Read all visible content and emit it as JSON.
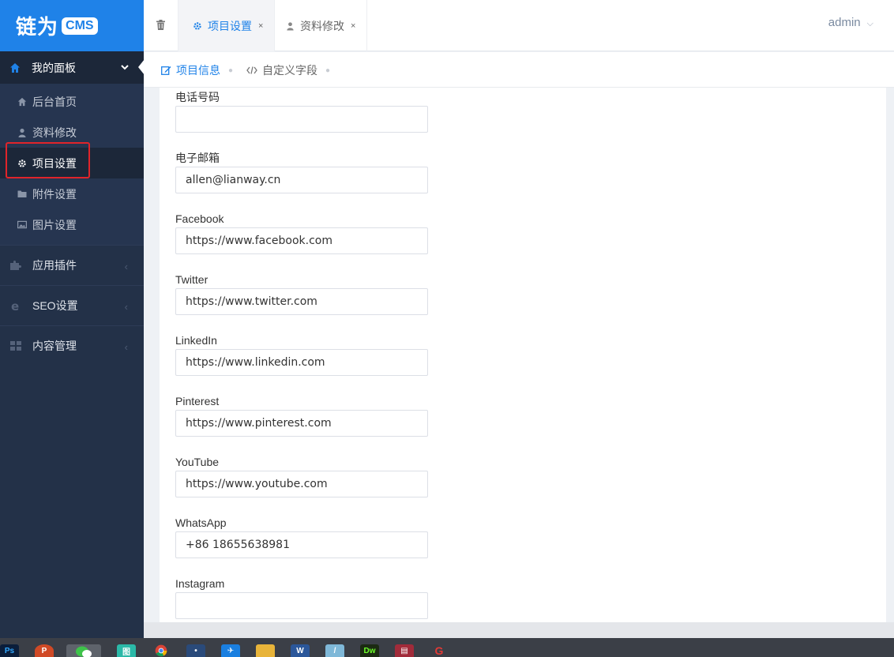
{
  "brand": {
    "name": "链为",
    "badge": "CMS",
    "color": "#1f82e8"
  },
  "sidebar": {
    "head_label": "我的面板",
    "sub_items": [
      {
        "label": "后台首页",
        "icon": "home-icon"
      },
      {
        "label": "资料修改",
        "icon": "user-icon"
      },
      {
        "label": "项目设置",
        "icon": "gear-icon",
        "active": true
      },
      {
        "label": "附件设置",
        "icon": "folder-icon"
      },
      {
        "label": "图片设置",
        "icon": "image-icon"
      }
    ],
    "groups": [
      {
        "label": "应用插件",
        "icon": "puzzle-icon"
      },
      {
        "label": "SEO设置",
        "icon": "ie-icon"
      },
      {
        "label": "内容管理",
        "icon": "grid-icon"
      }
    ]
  },
  "tabs": [
    {
      "label": "项目设置",
      "icon": "gear-icon",
      "close": "×"
    },
    {
      "label": "资料修改",
      "icon": "user-icon",
      "close": "×"
    }
  ],
  "user": {
    "name": "admin"
  },
  "subtabs": [
    {
      "label": "项目信息",
      "icon": "edit-icon"
    },
    {
      "label": "自定义字段",
      "icon": "code-icon"
    }
  ],
  "form": {
    "fields": [
      {
        "label": "电话号码",
        "value": ""
      },
      {
        "label": "电子邮箱",
        "value": "allen@lianway.cn"
      },
      {
        "label": "Facebook",
        "value": "https://www.facebook.com"
      },
      {
        "label": "Twitter",
        "value": "https://www.twitter.com"
      },
      {
        "label": "LinkedIn",
        "value": "https://www.linkedin.com"
      },
      {
        "label": "Pinterest",
        "value": "https://www.pinterest.com"
      },
      {
        "label": "YouTube",
        "value": "https://www.youtube.com"
      },
      {
        "label": "WhatsApp",
        "value": "+86 18655638981"
      },
      {
        "label": "Instagram",
        "value": ""
      }
    ]
  },
  "taskbar": {
    "apps": [
      {
        "name": "Ps",
        "color": "#0b1e3b"
      },
      {
        "name": "P",
        "color": "#d04a26"
      },
      {
        "name": "WeChat",
        "color": "#3ec34a"
      },
      {
        "name": "图",
        "color": "#2bb9a8"
      },
      {
        "name": "Chrome",
        "color": "#db4437"
      },
      {
        "name": "bot",
        "color": "#2a4a7a"
      },
      {
        "name": "app",
        "color": "#1a7fe0"
      },
      {
        "name": "folder",
        "color": "#e8b43a"
      },
      {
        "name": "W",
        "color": "#2b579a"
      },
      {
        "name": "pen",
        "color": "#7fb8d8"
      },
      {
        "name": "Dw",
        "color": "#1b2a12"
      },
      {
        "name": "db",
        "color": "#a12b3a"
      },
      {
        "name": "G",
        "color": "#c9302c"
      }
    ]
  }
}
